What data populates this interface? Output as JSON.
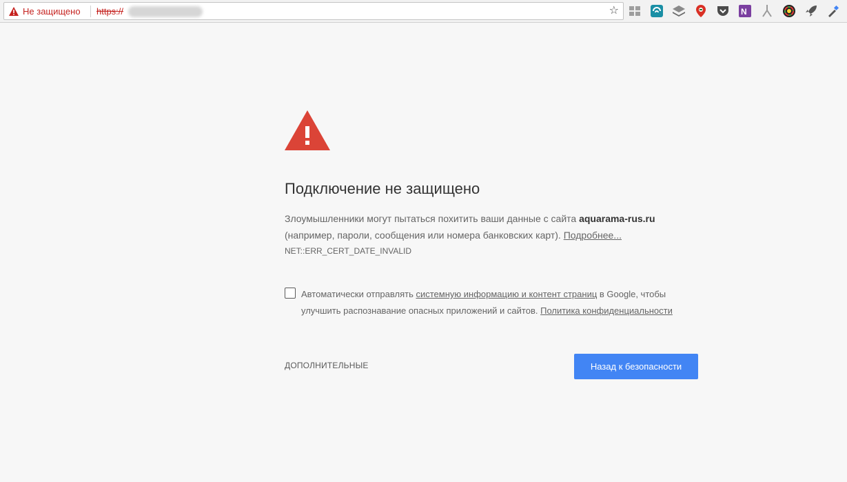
{
  "toolbar": {
    "security_status": "Не защищено",
    "url_scheme": "https://",
    "url_separator": "",
    "url_host": "hidden",
    "bookmark_icon": "star-icon",
    "extensions": [
      {
        "name": "apps-grid-icon",
        "color": "#9e9e9e"
      },
      {
        "name": "wave-extension-icon",
        "color": "#1a8fa5"
      },
      {
        "name": "layers-extension-icon",
        "color": "#7a7a7a"
      },
      {
        "name": "map-pin-extension-icon",
        "color": "#d93025"
      },
      {
        "name": "pocket-extension-icon",
        "color": "#4a4a4a"
      },
      {
        "name": "onenote-extension-icon",
        "color": "#7b3fa0"
      },
      {
        "name": "branch-extension-icon",
        "color": "#9a9a9a"
      },
      {
        "name": "color-wheel-extension-icon",
        "color": "#222222"
      },
      {
        "name": "rocket-extension-icon",
        "color": "#555555"
      },
      {
        "name": "eyedropper-extension-icon",
        "color": "#555555"
      }
    ]
  },
  "interstitial": {
    "title": "Подключение не защищено",
    "explanation_prefix": "Злоумышленники могут пытаться похитить ваши данные с сайта ",
    "site": "aquarama-rus.ru",
    "explanation_suffix": " (например, пароли, сообщения или номера банковских карт). ",
    "learn_more": "Подробнее...",
    "error_code": "NET::ERR_CERT_DATE_INVALID",
    "optin_prefix": "Автоматически отправлять ",
    "optin_link": "системную информацию и контент страниц",
    "optin_middle": " в Google, чтобы улучшить распознавание опасных приложений и сайтов. ",
    "privacy_link": "Политика конфиденциальности",
    "details_button": "Дополнительные",
    "primary_button": "Назад к безопасности",
    "accent_color": "#4285f4",
    "warning_color": "#db4437"
  }
}
